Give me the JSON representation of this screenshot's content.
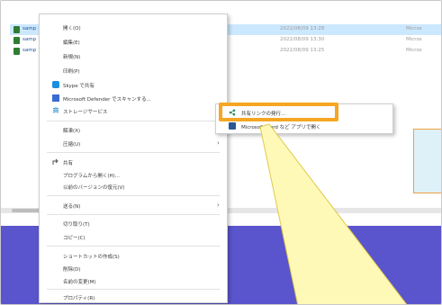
{
  "files": [
    {
      "name": "samp",
      "date": "2022/08/09 13:28",
      "type": "Micros",
      "selected": true
    },
    {
      "name": "samp",
      "date": "2022/08/09 13:30",
      "type": "Micros",
      "selected": false
    },
    {
      "name": "samp",
      "date": "2022/08/09 13:25",
      "type": "Micros",
      "selected": false
    }
  ],
  "menu": {
    "open": "開く(O)",
    "edit": "編集(E)",
    "new": "新規(N)",
    "print": "印刷(P)",
    "skype_share": "Skype で共有",
    "defender_scan": "Microsoft Defender でスキャンする...",
    "storage_service": "ストレージサービス",
    "decompress": "解凍(X)",
    "compress": "圧縮(U)",
    "share": "共有",
    "open_with": "プログラムから開く(H)...",
    "restore_previous": "以前のバージョンの復元(V)",
    "send_to": "送る(N)",
    "cut": "切り取り(T)",
    "copy": "コピー(C)",
    "create_shortcut": "ショートカットの作成(S)",
    "delete": "削除(D)",
    "rename": "名前の変更(M)",
    "properties": "プロパティ(R)"
  },
  "submenu": {
    "issue_share_link": "共有リンクの発行...",
    "open_in_app": "Microsoft Word など アプリで開く"
  },
  "colors": {
    "highlight": "#f5a623",
    "band": "#5a55cc",
    "selection": "#cce8ff"
  },
  "icons": {
    "skype": "skype-icon",
    "defender": "defender-icon",
    "storage": "storage-icon",
    "share": "share-icon",
    "link": "share-link-icon",
    "app": "app-icon"
  }
}
